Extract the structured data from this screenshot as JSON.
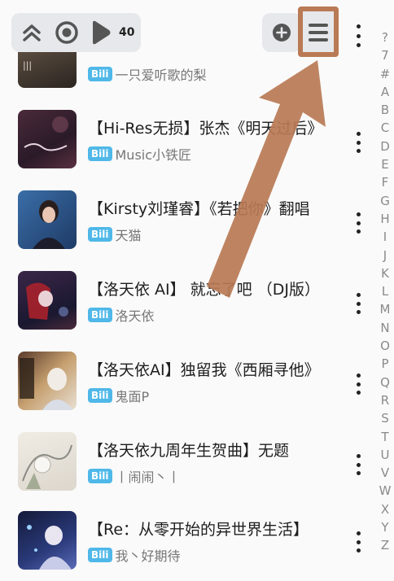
{
  "controls": {
    "count": "40"
  },
  "songs": [
    {
      "title": "",
      "artist": "一只爱听歌的梨",
      "badge": "Bili"
    },
    {
      "title": "【Hi-Res无损】张杰《明天过后》",
      "artist": "Music小铁匠",
      "badge": "Bili"
    },
    {
      "title": "【Kirsty刘瑾睿】《若把你》翻唱",
      "artist": "天猫",
      "badge": "Bili"
    },
    {
      "title": "【洛天依 AI】 就忘了吧 （DJ版）",
      "artist": "洛天依",
      "badge": "Bili"
    },
    {
      "title": "【洛天依AI】独留我《西厢寻他》",
      "artist": "鬼面P",
      "badge": "Bili"
    },
    {
      "title": "【洛天依九周年生贺曲】无题",
      "artist": "丨闹闹丶丨",
      "badge": "Bili"
    },
    {
      "title": "【Re：从零开始的异世界生活】",
      "artist": "我丶好期待",
      "badge": "Bili"
    }
  ],
  "alphabet": [
    "?",
    "7",
    "#",
    "A",
    "B",
    "C",
    "D",
    "E",
    "F",
    "G",
    "H",
    "I",
    "J",
    "K",
    "L",
    "M",
    "N",
    "O",
    "P",
    "Q",
    "R",
    "S",
    "T",
    "U",
    "V",
    "W",
    "X",
    "Y",
    "Z"
  ],
  "colors": {
    "accent_highlight": "#b97a55",
    "bili_badge": "#4fb8e8"
  }
}
